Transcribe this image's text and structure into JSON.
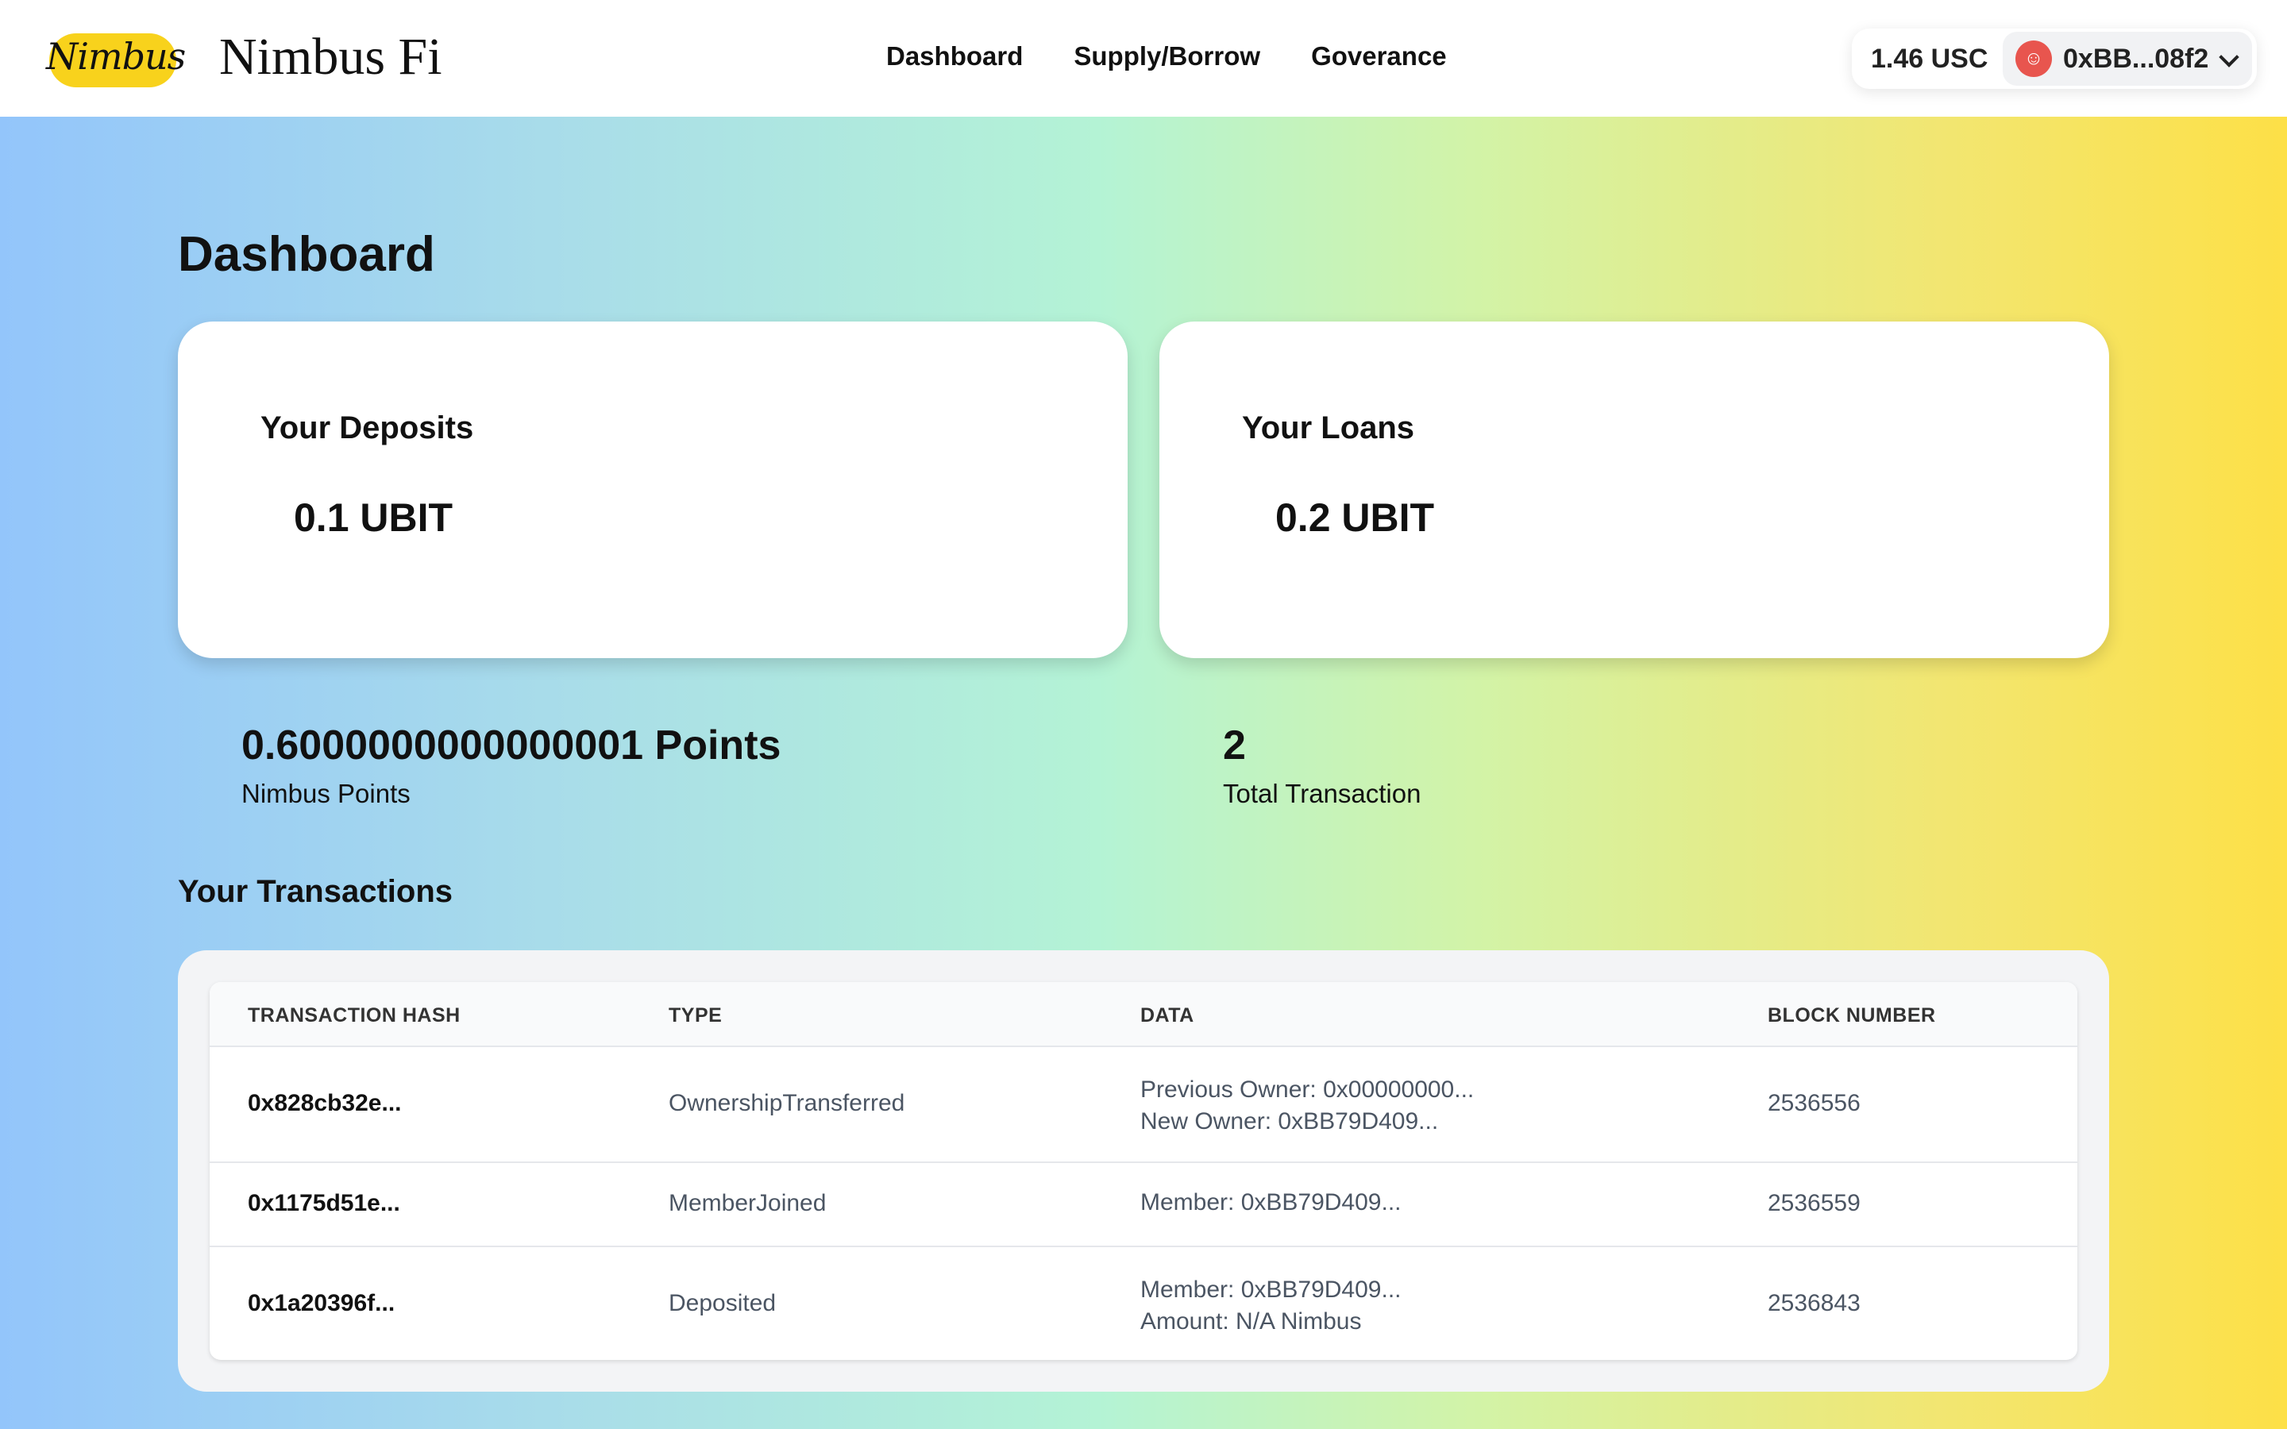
{
  "header": {
    "logo_text": "Nimbus",
    "brand": "Nimbus Fi",
    "nav": [
      "Dashboard",
      "Supply/Borrow",
      "Goverance"
    ],
    "balance": "1.46 USC",
    "address": "0xBB...08f2",
    "avatar_icon": "avatar-icon"
  },
  "page": {
    "title": "Dashboard"
  },
  "cards": {
    "deposits": {
      "title": "Your Deposits",
      "value": "0.1 UBIT"
    },
    "loans": {
      "title": "Your Loans",
      "value": "0.2 UBIT"
    }
  },
  "stats": {
    "points": {
      "value": "0.6000000000000001 Points",
      "label": "Nimbus Points"
    },
    "transactions": {
      "value": "2",
      "label": "Total Transaction"
    }
  },
  "transactions": {
    "title": "Your Transactions",
    "columns": [
      "TRANSACTION HASH",
      "TYPE",
      "DATA",
      "BLOCK NUMBER"
    ],
    "rows": [
      {
        "hash": "0x828cb32e...",
        "type": "OwnershipTransferred",
        "data": [
          "Previous Owner: 0x00000000...",
          "New Owner: 0xBB79D409..."
        ],
        "block": "2536556"
      },
      {
        "hash": "0x1175d51e...",
        "type": "MemberJoined",
        "data": [
          "Member: 0xBB79D409..."
        ],
        "block": "2536559"
      },
      {
        "hash": "0x1a20396f...",
        "type": "Deposited",
        "data": [
          "Member: 0xBB79D409...",
          "Amount: N/A Nimbus"
        ],
        "block": "2536843"
      }
    ]
  }
}
